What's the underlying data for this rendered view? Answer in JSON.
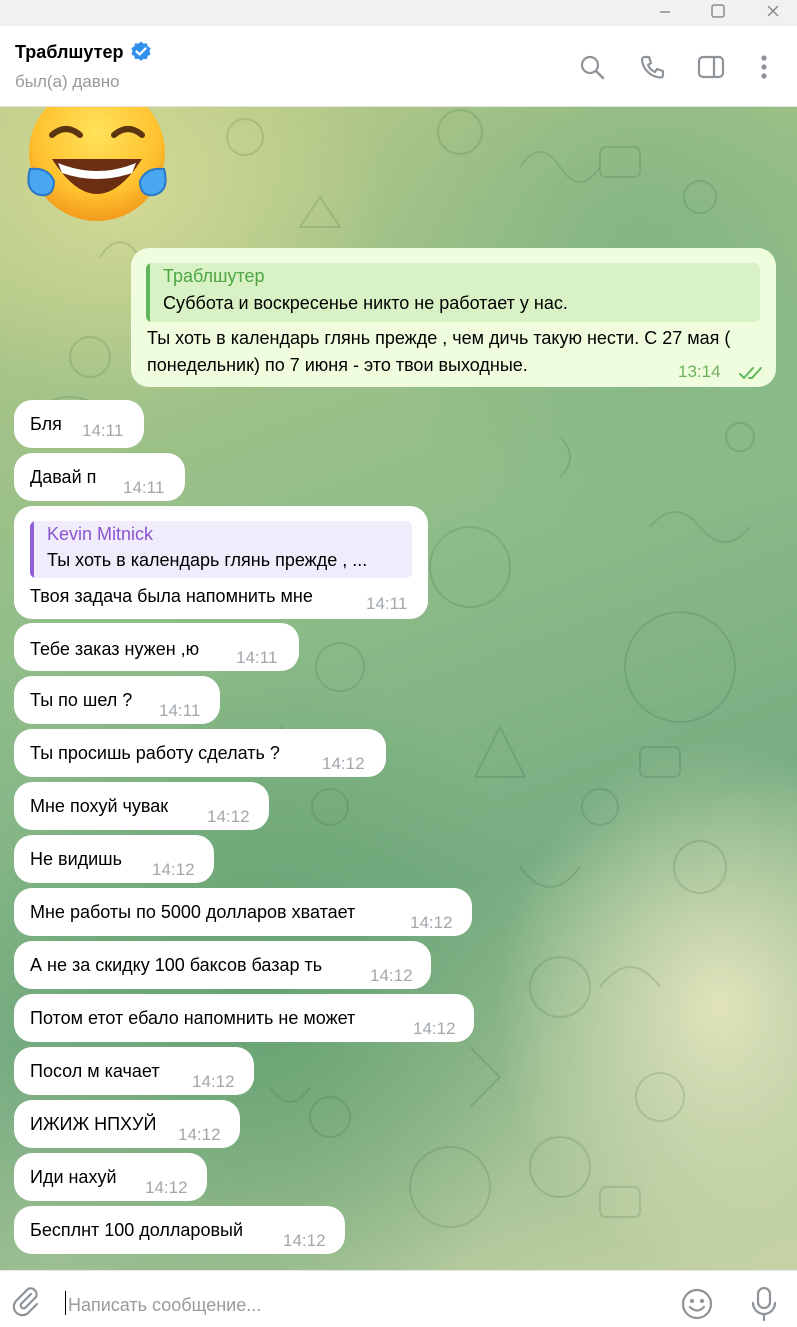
{
  "window": {
    "icons": [
      "minimize-icon",
      "maximize-icon",
      "close-icon"
    ]
  },
  "header": {
    "title": "Траблшутер",
    "status": "был(а) давно",
    "icons": [
      "verified-icon",
      "search-icon",
      "phone-icon",
      "sidebar-icon",
      "more-icon"
    ]
  },
  "outgoing": {
    "quote_author": "Траблшутер",
    "quote_text": "Суббота и воскресенье никто не работает у нас.",
    "text": "Ты хоть в календарь глянь прежде , чем дичь такую нести. С 27 мая ( понедельник) по 7 июня - это твои выходные.",
    "time": "13:14"
  },
  "reply": {
    "author": "Kevin Mitnick",
    "text": "Ты хоть в календарь глянь прежде , ..."
  },
  "messages": [
    {
      "text": "Бля",
      "time": "14:11"
    },
    {
      "text": "Давай п",
      "time": "14:11"
    },
    {
      "text": "Твоя задача была напомнить мне",
      "time": "14:11"
    },
    {
      "text": "Тебе заказ нужен ,ю",
      "time": "14:11"
    },
    {
      "text": "Ты по шел ?",
      "time": "14:11"
    },
    {
      "text": "Ты просишь работу сделать ?",
      "time": "14:12"
    },
    {
      "text": "Мне похуй чувак",
      "time": "14:12"
    },
    {
      "text": "Не видишь",
      "time": "14:12"
    },
    {
      "text": "Мне работы по 5000 долларов хватает",
      "time": "14:12"
    },
    {
      "text": "А не за скидку 100 баксов базар ть",
      "time": "14:12"
    },
    {
      "text": "Потом етот ебало напомнить не может",
      "time": "14:12"
    },
    {
      "text": "Посол м качает",
      "time": "14:12"
    },
    {
      "text": "ИЖИЖ НПХУЙ",
      "time": "14:12"
    },
    {
      "text": "Иди нахуй",
      "time": "14:12"
    },
    {
      "text": "Бесплнт 100 долларовый",
      "time": "14:12"
    }
  ],
  "composer": {
    "placeholder": "Написать сообщение...",
    "icons": [
      "attach-icon",
      "emoji-icon",
      "microphone-icon"
    ]
  },
  "colors": {
    "outgoing_bubble": "#effdde",
    "incoming_bubble": "#ffffff",
    "quote_accent": "#5fb55a",
    "reply_accent": "#8e5fd5",
    "verified": "#3390ec"
  }
}
